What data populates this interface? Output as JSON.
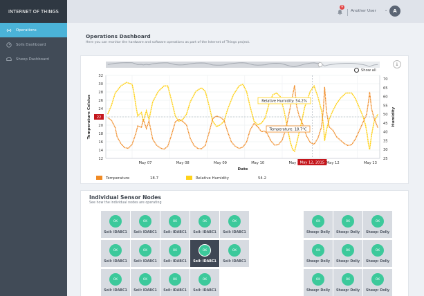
{
  "sidebar": {
    "brand": "INTERNET OF THINGS",
    "items": [
      {
        "label": "Operations",
        "icon": "radio-waves-icon",
        "active": true
      },
      {
        "label": "Soils Dashboard",
        "icon": "gauge-icon",
        "active": false
      },
      {
        "label": "Sheep Dashboard",
        "icon": "sheep-icon",
        "active": false
      }
    ]
  },
  "header": {
    "notification_count": "9",
    "user_name": "Another User",
    "user_caret": "⌄",
    "avatar_initial": "A"
  },
  "page": {
    "title": "Operations Dashboard",
    "subtitle": "Here you can monitor the hardware and software operations as part of the Internet of Things project."
  },
  "chart_data": {
    "type": "line",
    "xlabel": "Date",
    "x_ticks": [
      "May 07",
      "May 08",
      "May 09",
      "May 10",
      "May 11",
      "May 12",
      "May 13"
    ],
    "crosshair_x_label": "May 12, 2015",
    "crosshair_y_label": "22",
    "show_all_label": "Show all",
    "download_icon": "download-icon",
    "y_left": {
      "label": "Temperature Celsius",
      "ticks": [
        12,
        14,
        16,
        18,
        20,
        22,
        24,
        26,
        28,
        30,
        32
      ],
      "range": [
        12,
        32
      ]
    },
    "y_right": {
      "label": "Humidity",
      "ticks": [
        25,
        30,
        35,
        40,
        45,
        50,
        55,
        60,
        65,
        70
      ],
      "range": [
        25,
        72
      ]
    },
    "x_range_days": [
      6.3,
      13.6
    ],
    "series": [
      {
        "name": "Temperature",
        "color": "#f08a24",
        "legend_value": "18.7",
        "points": [
          [
            6.35,
            21.8
          ],
          [
            6.45,
            21.2
          ],
          [
            6.55,
            19.4
          ],
          [
            6.6,
            17.2
          ],
          [
            6.7,
            15.6
          ],
          [
            6.8,
            14.6
          ],
          [
            6.9,
            14.4
          ],
          [
            7.0,
            15.4
          ],
          [
            7.1,
            18.0
          ],
          [
            7.15,
            19.8
          ],
          [
            7.25,
            19.5
          ],
          [
            7.3,
            21.4
          ],
          [
            7.38,
            19.2
          ],
          [
            7.45,
            21.0
          ],
          [
            7.55,
            16.6
          ],
          [
            7.65,
            15.2
          ],
          [
            7.75,
            14.5
          ],
          [
            7.85,
            14.2
          ],
          [
            7.95,
            14.9
          ],
          [
            8.05,
            17.6
          ],
          [
            8.15,
            20.8
          ],
          [
            8.25,
            21.4
          ],
          [
            8.35,
            20.9
          ],
          [
            8.45,
            20.1
          ],
          [
            8.55,
            16.8
          ],
          [
            8.65,
            15.1
          ],
          [
            8.75,
            14.4
          ],
          [
            8.85,
            14.3
          ],
          [
            8.95,
            15.1
          ],
          [
            9.05,
            18.2
          ],
          [
            9.15,
            21.6
          ],
          [
            9.25,
            22.2
          ],
          [
            9.35,
            21.9
          ],
          [
            9.45,
            21.2
          ],
          [
            9.55,
            18.3
          ],
          [
            9.65,
            15.9
          ],
          [
            9.75,
            14.9
          ],
          [
            9.85,
            14.4
          ],
          [
            9.95,
            14.7
          ],
          [
            10.05,
            15.9
          ],
          [
            10.15,
            18.9
          ],
          [
            10.25,
            20.4
          ],
          [
            10.35,
            19.6
          ],
          [
            10.45,
            18.4
          ],
          [
            10.52,
            18.6
          ],
          [
            10.6,
            18.0
          ],
          [
            10.7,
            16.2
          ],
          [
            10.8,
            15.2
          ],
          [
            10.9,
            15.3
          ],
          [
            11.0,
            16.4
          ],
          [
            11.1,
            19.2
          ],
          [
            11.2,
            23.6
          ],
          [
            11.28,
            27.2
          ],
          [
            11.33,
            29.6
          ],
          [
            11.38,
            24.8
          ],
          [
            11.45,
            22.2
          ],
          [
            11.55,
            20.2
          ],
          [
            11.65,
            17.4
          ],
          [
            11.75,
            15.8
          ],
          [
            11.85,
            15.4
          ],
          [
            11.95,
            16.8
          ],
          [
            12.05,
            19.6
          ],
          [
            12.1,
            24.0
          ],
          [
            12.13,
            29.2
          ],
          [
            12.18,
            23.4
          ],
          [
            12.25,
            19.6
          ],
          [
            12.35,
            18.8
          ],
          [
            12.45,
            17.2
          ],
          [
            12.55,
            16.4
          ],
          [
            12.65,
            15.6
          ],
          [
            12.75,
            15.1
          ],
          [
            12.85,
            15.3
          ],
          [
            12.95,
            16.6
          ],
          [
            13.05,
            18.6
          ],
          [
            13.15,
            20.6
          ],
          [
            13.25,
            22.6
          ],
          [
            13.3,
            25.6
          ],
          [
            13.33,
            28.0
          ],
          [
            13.38,
            24.0
          ],
          [
            13.45,
            21.6
          ],
          [
            13.55,
            19.4
          ]
        ]
      },
      {
        "name": "Relative Humidity",
        "color": "#ffd21a",
        "legend_value": "54.2",
        "points": [
          [
            6.35,
            50
          ],
          [
            6.45,
            55
          ],
          [
            6.55,
            62
          ],
          [
            6.7,
            66
          ],
          [
            6.85,
            68
          ],
          [
            7.0,
            67
          ],
          [
            7.05,
            62
          ],
          [
            7.1,
            55
          ],
          [
            7.15,
            49
          ],
          [
            7.25,
            51
          ],
          [
            7.3,
            46
          ],
          [
            7.38,
            52
          ],
          [
            7.45,
            47
          ],
          [
            7.55,
            57
          ],
          [
            7.7,
            63
          ],
          [
            7.85,
            66
          ],
          [
            7.95,
            66
          ],
          [
            8.05,
            58
          ],
          [
            8.15,
            49
          ],
          [
            8.25,
            46
          ],
          [
            8.35,
            47
          ],
          [
            8.45,
            50
          ],
          [
            8.55,
            57
          ],
          [
            8.7,
            63
          ],
          [
            8.85,
            65
          ],
          [
            8.95,
            63
          ],
          [
            9.05,
            55
          ],
          [
            9.15,
            46
          ],
          [
            9.25,
            43
          ],
          [
            9.35,
            44
          ],
          [
            9.45,
            46
          ],
          [
            9.55,
            53
          ],
          [
            9.7,
            61
          ],
          [
            9.85,
            66
          ],
          [
            9.95,
            67
          ],
          [
            10.05,
            63
          ],
          [
            10.15,
            54
          ],
          [
            10.25,
            46
          ],
          [
            10.35,
            44
          ],
          [
            10.45,
            45
          ],
          [
            10.55,
            48
          ],
          [
            10.65,
            56
          ],
          [
            10.75,
            61
          ],
          [
            10.85,
            62
          ],
          [
            10.95,
            60
          ],
          [
            11.05,
            52
          ],
          [
            11.15,
            41
          ],
          [
            11.22,
            34
          ],
          [
            11.28,
            30
          ],
          [
            11.33,
            29
          ],
          [
            11.4,
            35
          ],
          [
            11.5,
            44
          ],
          [
            11.6,
            54
          ],
          [
            11.75,
            63
          ],
          [
            11.85,
            66
          ],
          [
            11.95,
            60
          ],
          [
            12.05,
            52
          ],
          [
            12.1,
            44
          ],
          [
            12.13,
            35
          ],
          [
            12.18,
            41
          ],
          [
            12.25,
            47
          ],
          [
            12.35,
            52
          ],
          [
            12.45,
            56
          ],
          [
            12.55,
            59
          ],
          [
            12.7,
            62
          ],
          [
            12.85,
            62
          ],
          [
            12.95,
            59
          ],
          [
            13.05,
            54
          ],
          [
            13.15,
            49
          ],
          [
            13.22,
            44
          ],
          [
            13.27,
            38
          ],
          [
            13.3,
            33
          ],
          [
            13.33,
            30
          ],
          [
            13.38,
            38
          ],
          [
            13.45,
            46
          ],
          [
            13.55,
            50
          ]
        ]
      }
    ],
    "tooltips": [
      {
        "text": "Relative Humidity: 54.2%"
      },
      {
        "text": "Temperature: 18.7°C"
      }
    ]
  },
  "sensors": {
    "title": "Individual Sensor Nodes",
    "subtitle": "See how the individual nodes are operating",
    "soil_nodes": [
      {
        "status": "OK",
        "label": "Soil: IDABC1",
        "selected": false
      },
      {
        "status": "OK",
        "label": "Soil: IDABC1",
        "selected": false
      },
      {
        "status": "OK",
        "label": "Soil: IDABC1",
        "selected": false
      },
      {
        "status": "OK",
        "label": "Soil: IDABC1",
        "selected": false
      },
      {
        "status": "OK",
        "label": "Soil: IDABC1",
        "selected": false
      },
      {
        "status": "OK",
        "label": "Soil: IDABC1",
        "selected": false
      },
      {
        "status": "OK",
        "label": "Soil: IDABC1",
        "selected": false
      },
      {
        "status": "OK",
        "label": "Soil: IDABC1",
        "selected": false
      },
      {
        "status": "OK",
        "label": "Soil: IDABC1",
        "selected": true
      },
      {
        "status": "OK",
        "label": "Soil: IDABC1",
        "selected": false
      },
      {
        "status": "OK",
        "label": "Soil: IDABC1",
        "selected": false
      },
      {
        "status": "OK",
        "label": "Soil: IDABC1",
        "selected": false
      },
      {
        "status": "OK",
        "label": "Soil: IDABC1",
        "selected": false
      },
      {
        "status": "OK",
        "label": "Soil: IDABC1",
        "selected": false
      }
    ],
    "sheep_nodes": [
      {
        "status": "OK",
        "label": "Sheep: Dolly"
      },
      {
        "status": "OK",
        "label": "Sheep: Dolly"
      },
      {
        "status": "OK",
        "label": "Sheep: Dolly"
      },
      {
        "status": "OK",
        "label": "Sheep: Dolly"
      },
      {
        "status": "OK",
        "label": "Sheep: Dolly"
      },
      {
        "status": "OK",
        "label": "Sheep: Dolly"
      },
      {
        "status": "OK",
        "label": "Sheep: Dolly"
      },
      {
        "status": "OK",
        "label": "Sheep: Dolly"
      },
      {
        "status": "OK",
        "label": "Sheep: Dolly"
      }
    ]
  }
}
